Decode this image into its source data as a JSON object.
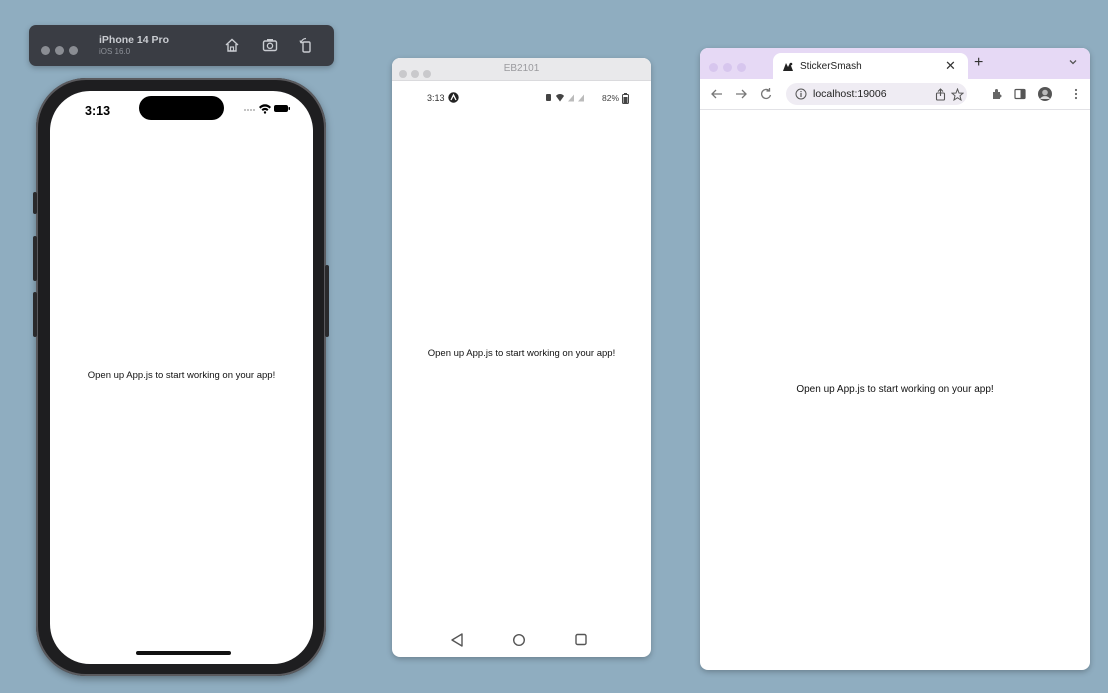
{
  "ios_simulator": {
    "toolbar": {
      "device_name": "iPhone 14 Pro",
      "os_version": "iOS 16.0",
      "buttons": [
        "home-icon",
        "screenshot-icon",
        "rotate-icon"
      ]
    },
    "status_bar": {
      "time": "3:13"
    },
    "message": "Open up App.js to start working on your app!"
  },
  "android_emulator": {
    "window_title": "EB2101",
    "status_bar": {
      "time": "3:13",
      "battery": "82%"
    },
    "message": "Open up App.js to start working on your app!",
    "nav_buttons": [
      "back-icon",
      "home-icon",
      "recents-icon"
    ]
  },
  "browser": {
    "tab": {
      "title": "StickerSmash"
    },
    "address_bar": {
      "url": "localhost:19006"
    },
    "message": "Open up App.js to start working on your app!"
  },
  "colors": {
    "desktop_background": "#8fadc0",
    "chrome_tabstrip": "#e6d9f5",
    "ios_toolbar": "#3a3d44"
  }
}
